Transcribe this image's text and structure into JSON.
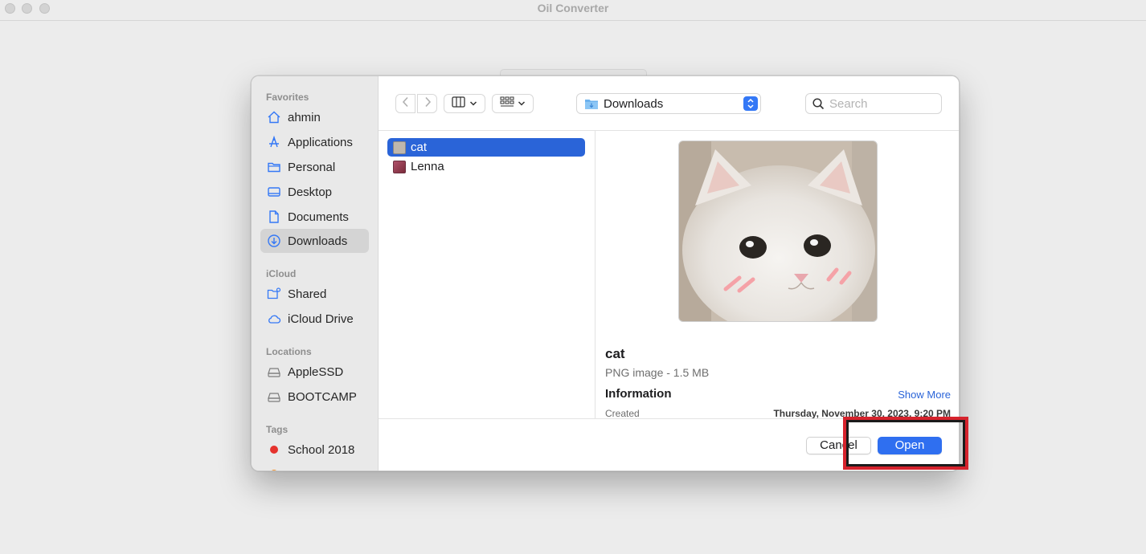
{
  "window": {
    "title": "Oil Converter"
  },
  "sidebar": {
    "sections": [
      {
        "heading": "Favorites"
      },
      {
        "heading": "iCloud"
      },
      {
        "heading": "Locations"
      },
      {
        "heading": "Tags"
      }
    ],
    "favorites": [
      {
        "label": "ahmin",
        "icon": "house-icon"
      },
      {
        "label": "Applications",
        "icon": "applications-icon"
      },
      {
        "label": "Personal",
        "icon": "folder-icon"
      },
      {
        "label": "Desktop",
        "icon": "desktop-icon"
      },
      {
        "label": "Documents",
        "icon": "document-icon"
      },
      {
        "label": "Downloads",
        "icon": "download-icon",
        "selected": true
      }
    ],
    "icloud": [
      {
        "label": "Shared",
        "icon": "shared-folder-icon"
      },
      {
        "label": "iCloud Drive",
        "icon": "cloud-icon"
      }
    ],
    "locations": [
      {
        "label": "AppleSSD",
        "icon": "drive-icon"
      },
      {
        "label": "BOOTCAMP",
        "icon": "drive-icon"
      }
    ],
    "tags": [
      {
        "label": "School 2018",
        "color": "#e5322d"
      },
      {
        "label": "",
        "color": "#f28a1e"
      }
    ]
  },
  "toolbar": {
    "path": "Downloads",
    "search_placeholder": "Search"
  },
  "files": [
    {
      "name": "cat",
      "selected": true
    },
    {
      "name": "Lenna",
      "selected": false
    }
  ],
  "preview": {
    "name": "cat",
    "kind": "PNG image - 1.5 MB",
    "info_heading": "Information",
    "show_more": "Show More",
    "created_label": "Created",
    "created_value": "Thursday, November 30, 2023, 9:20 PM"
  },
  "buttons": {
    "cancel": "Cancel",
    "open": "Open"
  },
  "colors": {
    "accent": "#2f6ff0",
    "selection": "#2a64d8",
    "highlight": "#d6232d"
  }
}
